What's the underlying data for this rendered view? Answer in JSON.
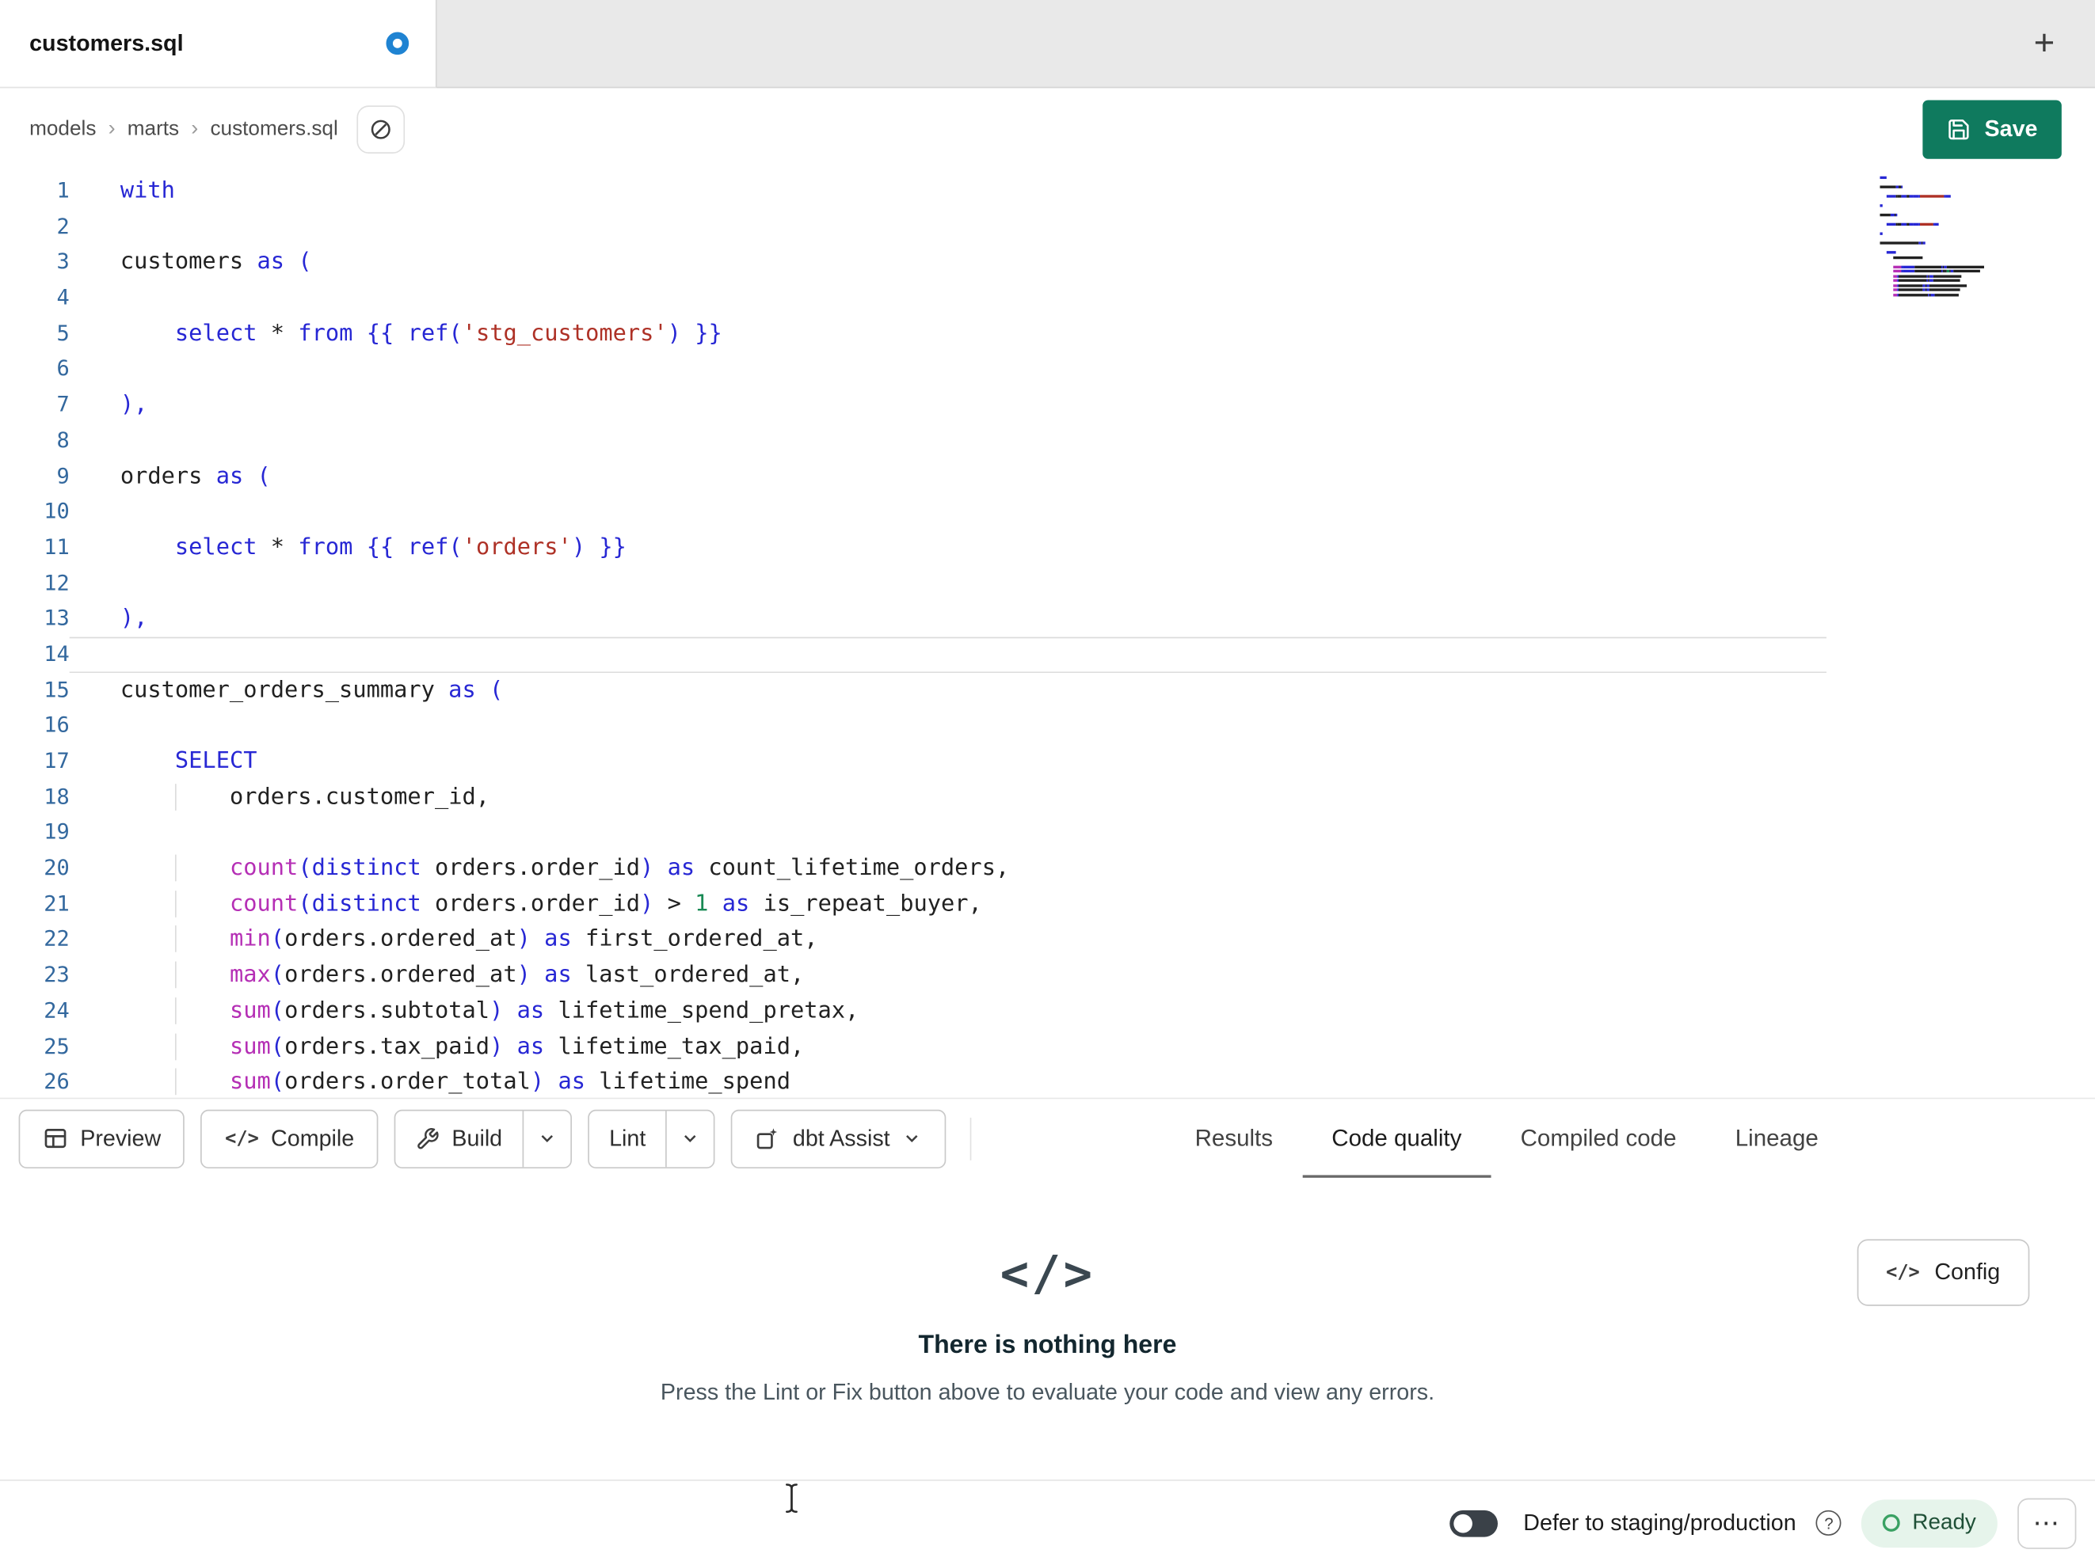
{
  "colors": {
    "accent_green": "#0f7a5e",
    "unsaved_dot": "#1f83d2",
    "ready_bg": "#e6f4eb",
    "ready_icon": "#3aa163",
    "syntax": {
      "kw": "#2727d4",
      "fn": "#b52fb5",
      "str": "#ae3126",
      "num": "#188954",
      "id": "#212121",
      "br": "#2727d4",
      "op": "#212121",
      "gutter": "#33689e"
    }
  },
  "tab_bar": {
    "active_tab": "customers.sql",
    "new_tab_icon": "+"
  },
  "breadcrumb": {
    "items": [
      "models",
      "marts",
      "customers.sql"
    ],
    "separator": "›"
  },
  "header": {
    "save_label": "Save"
  },
  "editor": {
    "lines": [
      {
        "n": 1,
        "tokens": [
          [
            "kw",
            "with"
          ]
        ]
      },
      {
        "n": 2,
        "tokens": []
      },
      {
        "n": 3,
        "tokens": [
          [
            "id",
            "customers "
          ],
          [
            "kw",
            "as"
          ],
          [
            "id",
            " "
          ],
          [
            "br",
            "("
          ]
        ]
      },
      {
        "n": 4,
        "tokens": []
      },
      {
        "n": 5,
        "tokens": [
          [
            "ws",
            "    "
          ],
          [
            "kw",
            "select"
          ],
          [
            "id",
            " "
          ],
          [
            "op",
            "*"
          ],
          [
            "id",
            " "
          ],
          [
            "kw",
            "from"
          ],
          [
            "id",
            " "
          ],
          [
            "br",
            "{{ "
          ],
          [
            "kw",
            "ref"
          ],
          [
            "br",
            "("
          ],
          [
            "str",
            "'stg_customers'"
          ],
          [
            "br",
            ")"
          ],
          [
            "br",
            " }}"
          ]
        ]
      },
      {
        "n": 6,
        "tokens": []
      },
      {
        "n": 7,
        "tokens": [
          [
            "br",
            "),"
          ]
        ]
      },
      {
        "n": 8,
        "tokens": []
      },
      {
        "n": 9,
        "tokens": [
          [
            "id",
            "orders "
          ],
          [
            "kw",
            "as"
          ],
          [
            "id",
            " "
          ],
          [
            "br",
            "("
          ]
        ]
      },
      {
        "n": 10,
        "tokens": []
      },
      {
        "n": 11,
        "tokens": [
          [
            "ws",
            "    "
          ],
          [
            "kw",
            "select"
          ],
          [
            "id",
            " "
          ],
          [
            "op",
            "*"
          ],
          [
            "id",
            " "
          ],
          [
            "kw",
            "from"
          ],
          [
            "id",
            " "
          ],
          [
            "br",
            "{{ "
          ],
          [
            "kw",
            "ref"
          ],
          [
            "br",
            "("
          ],
          [
            "str",
            "'orders'"
          ],
          [
            "br",
            ")"
          ],
          [
            "br",
            " }}"
          ]
        ]
      },
      {
        "n": 12,
        "tokens": []
      },
      {
        "n": 13,
        "tokens": [
          [
            "br",
            "),"
          ]
        ]
      },
      {
        "n": 14,
        "tokens": [],
        "active": true
      },
      {
        "n": 15,
        "tokens": [
          [
            "id",
            "customer_orders_summary "
          ],
          [
            "kw",
            "as"
          ],
          [
            "id",
            " "
          ],
          [
            "br",
            "("
          ]
        ]
      },
      {
        "n": 16,
        "tokens": []
      },
      {
        "n": 17,
        "tokens": [
          [
            "ws",
            "    "
          ],
          [
            "kw",
            "SELECT"
          ]
        ]
      },
      {
        "n": 18,
        "tokens": [
          [
            "ws",
            "        "
          ],
          [
            "id",
            "orders.customer_id,"
          ]
        ]
      },
      {
        "n": 19,
        "tokens": []
      },
      {
        "n": 20,
        "tokens": [
          [
            "ws",
            "        "
          ],
          [
            "fn",
            "count"
          ],
          [
            "br",
            "("
          ],
          [
            "kw",
            "distinct"
          ],
          [
            "id",
            " orders.order_id"
          ],
          [
            "br",
            ")"
          ],
          [
            "id",
            " "
          ],
          [
            "kw",
            "as"
          ],
          [
            "id",
            " count_lifetime_orders,"
          ]
        ]
      },
      {
        "n": 21,
        "tokens": [
          [
            "ws",
            "        "
          ],
          [
            "fn",
            "count"
          ],
          [
            "br",
            "("
          ],
          [
            "kw",
            "distinct"
          ],
          [
            "id",
            " orders.order_id"
          ],
          [
            "br",
            ")"
          ],
          [
            "id",
            " "
          ],
          [
            "op",
            ">"
          ],
          [
            "id",
            " "
          ],
          [
            "num",
            "1"
          ],
          [
            "id",
            " "
          ],
          [
            "kw",
            "as"
          ],
          [
            "id",
            " is_repeat_buyer,"
          ]
        ]
      },
      {
        "n": 22,
        "tokens": [
          [
            "ws",
            "        "
          ],
          [
            "fn",
            "min"
          ],
          [
            "br",
            "("
          ],
          [
            "id",
            "orders.ordered_at"
          ],
          [
            "br",
            ")"
          ],
          [
            "id",
            " "
          ],
          [
            "kw",
            "as"
          ],
          [
            "id",
            " first_ordered_at,"
          ]
        ]
      },
      {
        "n": 23,
        "tokens": [
          [
            "ws",
            "        "
          ],
          [
            "fn",
            "max"
          ],
          [
            "br",
            "("
          ],
          [
            "id",
            "orders.ordered_at"
          ],
          [
            "br",
            ")"
          ],
          [
            "id",
            " "
          ],
          [
            "kw",
            "as"
          ],
          [
            "id",
            " last_ordered_at,"
          ]
        ]
      },
      {
        "n": 24,
        "tokens": [
          [
            "ws",
            "        "
          ],
          [
            "fn",
            "sum"
          ],
          [
            "br",
            "("
          ],
          [
            "id",
            "orders.subtotal"
          ],
          [
            "br",
            ")"
          ],
          [
            "id",
            " "
          ],
          [
            "kw",
            "as"
          ],
          [
            "id",
            " lifetime_spend_pretax,"
          ]
        ]
      },
      {
        "n": 25,
        "tokens": [
          [
            "ws",
            "        "
          ],
          [
            "fn",
            "sum"
          ],
          [
            "br",
            "("
          ],
          [
            "id",
            "orders.tax_paid"
          ],
          [
            "br",
            ")"
          ],
          [
            "id",
            " "
          ],
          [
            "kw",
            "as"
          ],
          [
            "id",
            " lifetime_tax_paid,"
          ]
        ]
      },
      {
        "n": 26,
        "tokens": [
          [
            "ws",
            "        "
          ],
          [
            "fn",
            "sum"
          ],
          [
            "br",
            "("
          ],
          [
            "id",
            "orders.order_total"
          ],
          [
            "br",
            ")"
          ],
          [
            "id",
            " "
          ],
          [
            "kw",
            "as"
          ],
          [
            "id",
            " lifetime_spend"
          ]
        ]
      }
    ]
  },
  "toolbar": {
    "preview": "Preview",
    "compile": "Compile",
    "compile_icon": "</>",
    "build": "Build",
    "lint": "Lint",
    "dbt_assist": "dbt Assist"
  },
  "results_tabs": [
    {
      "label": "Results",
      "active": false
    },
    {
      "label": "Code quality",
      "active": true
    },
    {
      "label": "Compiled code",
      "active": false
    },
    {
      "label": "Lineage",
      "active": false
    }
  ],
  "panel": {
    "icon": "</>",
    "title": "There is nothing here",
    "subtitle": "Press the Lint or Fix button above to evaluate your code and view any errors.",
    "config": {
      "icon": "</>",
      "label": "Config"
    }
  },
  "status_bar": {
    "defer_label": "Defer to staging/production",
    "help_icon": "?",
    "ready_label": "Ready",
    "menu_icon": "⋯"
  }
}
